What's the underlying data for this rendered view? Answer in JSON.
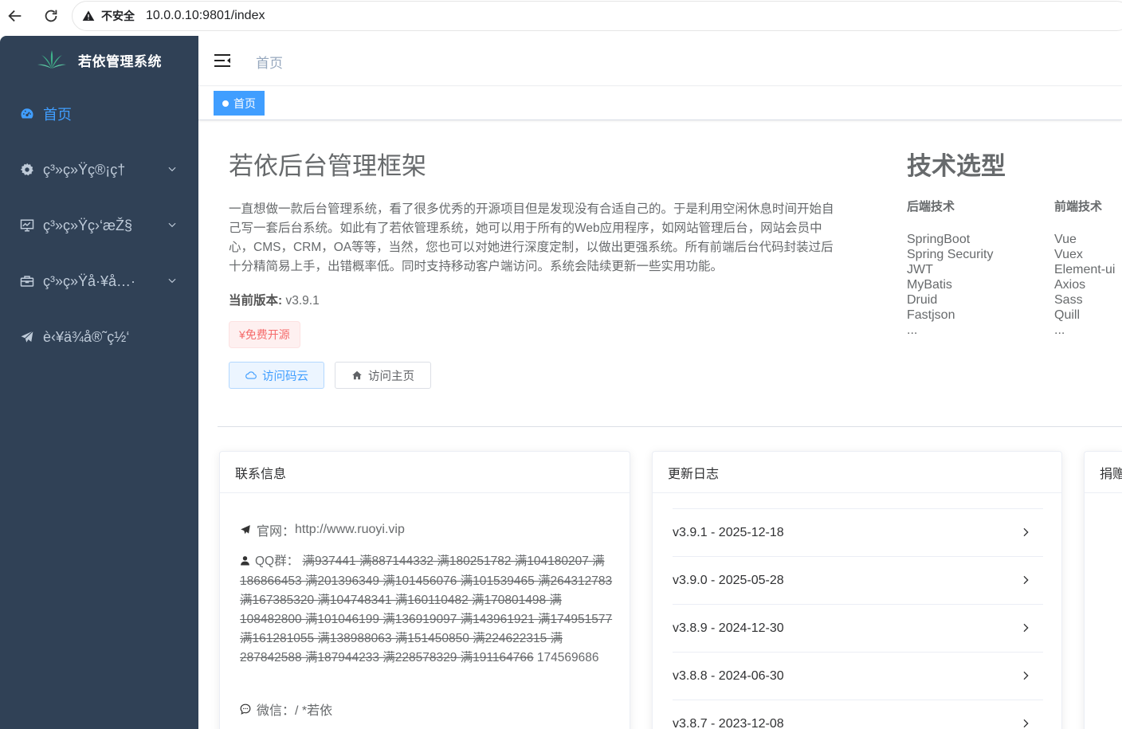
{
  "browser": {
    "security_label": "不安全",
    "url": "10.0.0.10:9801/index"
  },
  "sidebar": {
    "logo_title": "若依管理系统",
    "items": [
      {
        "label": "首页",
        "icon": "dashboard-icon"
      },
      {
        "label": "ç³»ç»Ÿç®¡ç†",
        "icon": "gear-icon"
      },
      {
        "label": "ç³»ç»Ÿç›‘æŽ§",
        "icon": "monitor-icon"
      },
      {
        "label": "ç³»ç»Ÿå·¥å…·",
        "icon": "toolbox-icon"
      },
      {
        "label": "è‹¥ä¾å®˜ç½‘",
        "icon": "paper-plane-icon"
      }
    ]
  },
  "header": {
    "breadcrumb": "首页"
  },
  "tags": {
    "active": "首页"
  },
  "intro": {
    "title": "若依后台管理框架",
    "description": "一直想做一款后台管理系统，看了很多优秀的开源项目但是发现没有合适自己的。于是利用空闲休息时间开始自己写一套后台系统。如此有了若依管理系统，她可以用于所有的Web应用程序，如网站管理后台，网站会员中心，CMS，CRM，OA等等，当然，您也可以对她进行深度定制，以做出更强系统。所有前端后台代码封装过后十分精简易上手，出错概率低。同时支持移动客户端访问。系统会陆续更新一些实用功能。",
    "version_label": "当前版本:",
    "version_value": "v3.9.1",
    "free_tag": "¥免费开源",
    "btn_gitee": "访问码云",
    "btn_home": "访问主页"
  },
  "tech": {
    "title": "技术选型",
    "backend_title": "后端技术",
    "backend": [
      "SpringBoot",
      "Spring Security",
      "JWT",
      "MyBatis",
      "Druid",
      "Fastjson",
      "..."
    ],
    "frontend_title": "前端技术",
    "frontend": [
      "Vue",
      "Vuex",
      "Element-ui",
      "Axios",
      "Sass",
      "Quill",
      "..."
    ]
  },
  "contact": {
    "header": "联系信息",
    "site_label": "官网：",
    "site_url": "http://www.ruoyi.vip",
    "qq_label": "QQ群：",
    "qq_struck": "满937441 满887144332 满180251782 满104180207 满186866453 满201396349 满101456076 满101539465 满264312783 满167385320 满104748341 满160110482 满170801498 满108482800 满101046199 满136919097 满143961921 满174951577 满161281055 满138988063 满151450850 满224622315 满287842588 满187944233 满228578329 满191164766",
    "qq_current": "174569686",
    "wechat_label": "微信：",
    "wechat_value": "/ *若依"
  },
  "changelog": {
    "header": "更新日志",
    "entries": [
      "v3.9.1 - 2025-12-18",
      "v3.9.0 - 2025-05-28",
      "v3.8.9 - 2024-12-30",
      "v3.8.8 - 2024-06-30",
      "v3.8.7 - 2023-12-08"
    ]
  },
  "donate": {
    "header": "捐赠"
  },
  "colors": {
    "sidebar_bg": "#304156",
    "accent": "#409eff",
    "danger": "#f56c6c"
  }
}
